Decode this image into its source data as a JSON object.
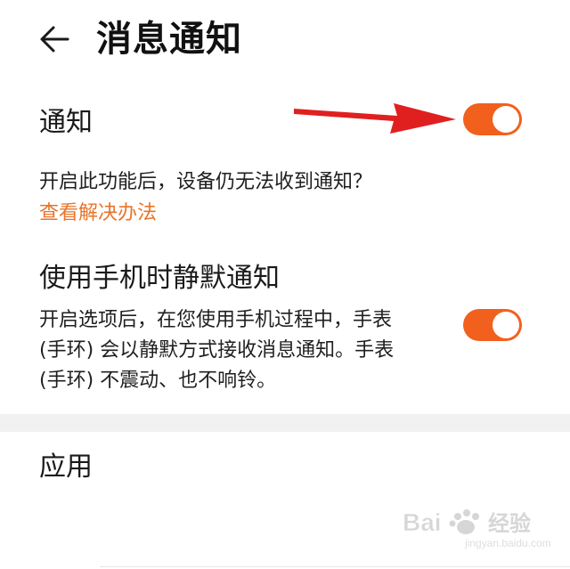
{
  "header": {
    "back_icon": "arrow-left-icon",
    "title": "消息通知"
  },
  "notify": {
    "label": "通知",
    "toggle_on": true,
    "hint": "开启此功能后，设备仍无法收到通知？",
    "solution_link": "查看解决办法"
  },
  "silent": {
    "title": "使用手机时静默通知",
    "description_lines": [
      "开启选项后，在您使用手机过程中，手表",
      "(手环) 会以静默方式接收消息通知。手表",
      "(手环) 不震动、也不响铃。"
    ],
    "toggle_on": true
  },
  "apps": {
    "header": "应用"
  },
  "watermark": {
    "text": "Bai经验",
    "sub": "jingyan.baidu.com"
  },
  "colors": {
    "accent": "#f2601e",
    "link": "#e8742a",
    "arrow": "#e0201f"
  }
}
